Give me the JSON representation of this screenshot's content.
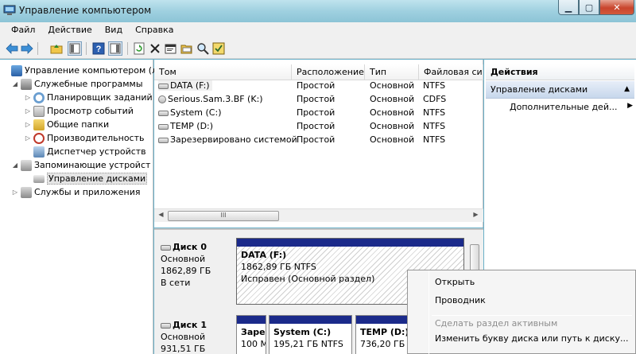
{
  "window": {
    "title": "Управление компьютером"
  },
  "menu": [
    "Файл",
    "Действие",
    "Вид",
    "Справка"
  ],
  "tree": {
    "root": "Управление компьютером (л",
    "system_tools": "Служебные программы",
    "task_scheduler": "Планировщик заданий",
    "event_viewer": "Просмотр событий",
    "shared_folders": "Общие папки",
    "performance": "Производительность",
    "device_manager": "Диспетчер устройств",
    "storage": "Запоминающие устройст",
    "disk_management": "Управление дисками",
    "services": "Службы и приложения"
  },
  "volumes": {
    "columns": [
      "Том",
      "Расположение",
      "Тип",
      "Файловая сис"
    ],
    "rows": [
      {
        "name": "DATA (F:)",
        "layout": "Простой",
        "type": "Основной",
        "fs": "NTFS"
      },
      {
        "name": "Serious.Sam.3.BF (K:)",
        "layout": "Простой",
        "type": "Основной",
        "fs": "CDFS"
      },
      {
        "name": "System (C:)",
        "layout": "Простой",
        "type": "Основной",
        "fs": "NTFS"
      },
      {
        "name": "TEMP (D:)",
        "layout": "Простой",
        "type": "Основной",
        "fs": "NTFS"
      },
      {
        "name": "Зарезервировано системой",
        "layout": "Простой",
        "type": "Основной",
        "fs": "NTFS"
      }
    ],
    "scroll_thumb": "III"
  },
  "disks": [
    {
      "name": "Диск 0",
      "type": "Основной",
      "size": "1862,89 ГБ",
      "status": "В сети"
    },
    {
      "name": "Диск 1",
      "type": "Основной",
      "size": "931,51 ГБ"
    }
  ],
  "partitions": {
    "data": {
      "name": "DATA  (F:)",
      "size": "1862,89 ГБ NTFS",
      "status": "Исправен (Основной раздел)"
    },
    "reserved": {
      "name": "Заре",
      "size": "100 М"
    },
    "system": {
      "name": "System  (C:)",
      "size": "195,21 ГБ NTFS"
    },
    "temp": {
      "name": "TEMP  (D:)",
      "size": "736,20 ГБ N"
    }
  },
  "actions": {
    "title": "Действия",
    "section": "Управление дисками",
    "more": "Дополнительные дей..."
  },
  "context_menu": {
    "open": "Открыть",
    "explore": "Проводник",
    "mark_active": "Сделать раздел активным",
    "change_letter": "Изменить букву диска или путь к диску..."
  }
}
